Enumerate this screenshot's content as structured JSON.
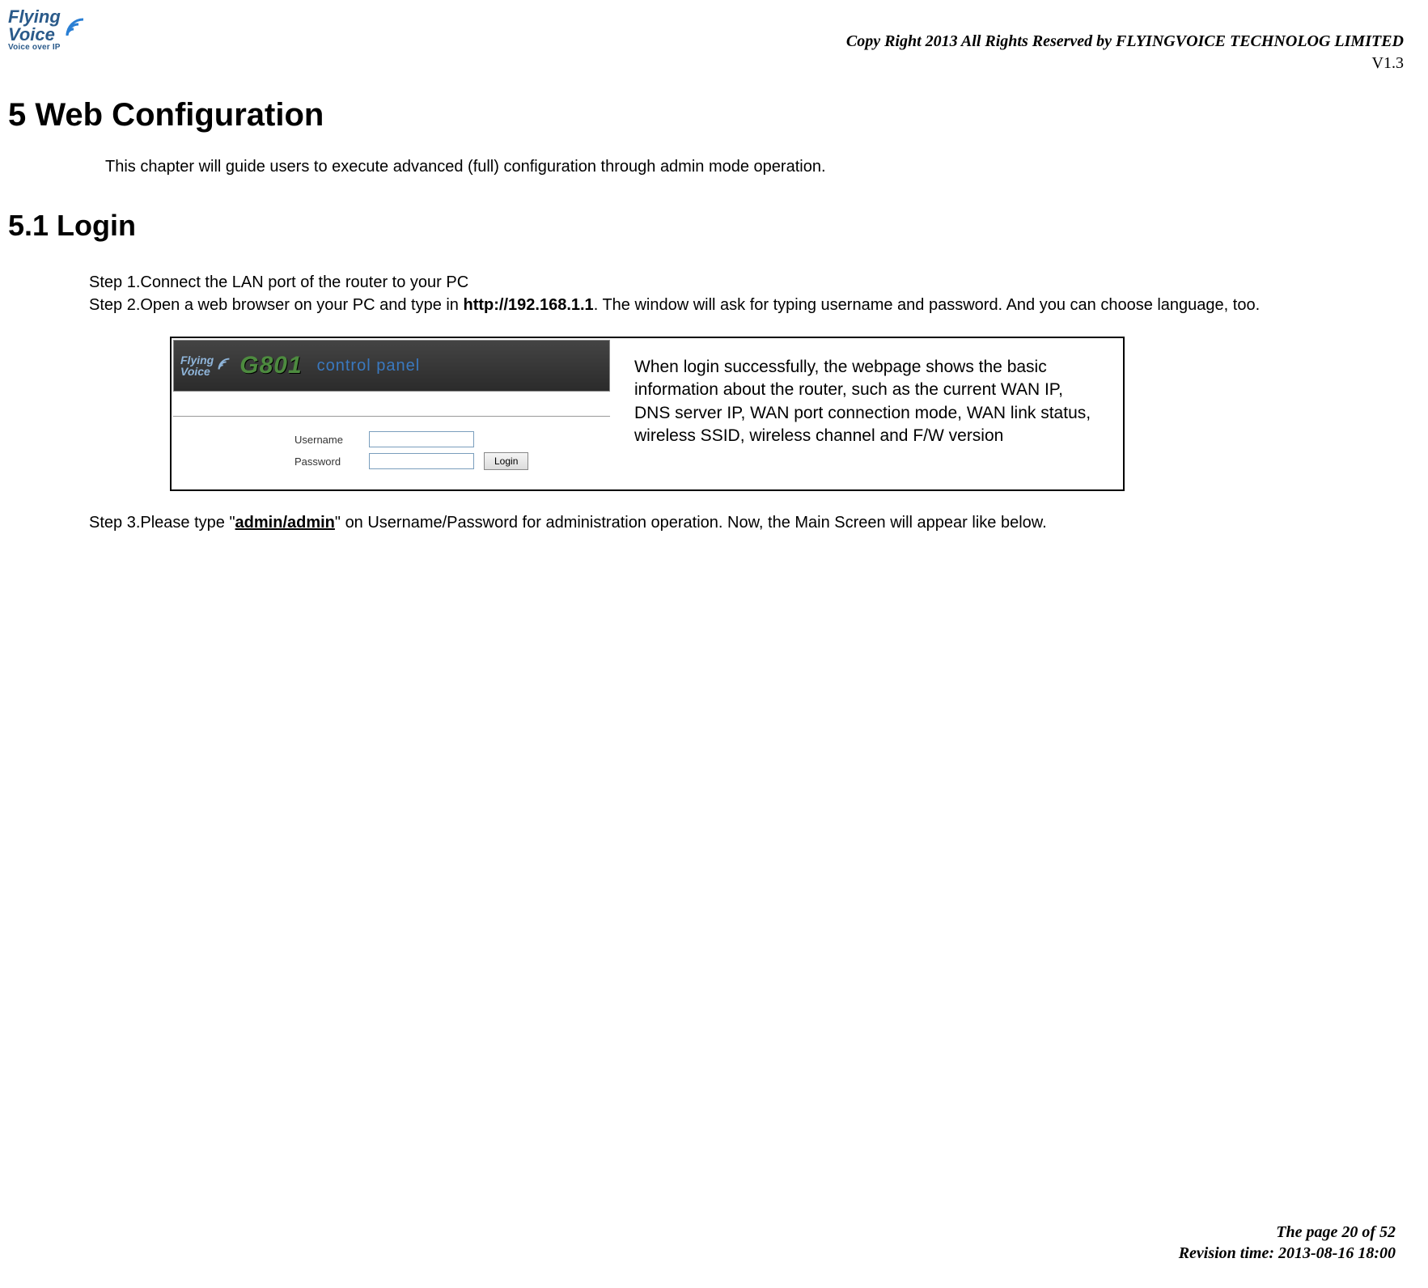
{
  "header": {
    "logo": {
      "line1": "Flying",
      "line2": "Voice",
      "sub": "Voice over IP"
    },
    "copyright": "Copy Right 2013 All Rights Reserved by FLYINGVOICE TECHNOLOG LIMITED",
    "version": "V1.3"
  },
  "title": "5   Web Configuration",
  "intro": "This chapter will guide users to execute advanced (full) configuration through admin mode operation.",
  "subtitle": "5.1 Login",
  "steps": {
    "s1": "Step 1.Connect the LAN port of the router to your PC",
    "s2a": "Step 2.Open a web browser on your PC and type in ",
    "s2b": "http://192.168.1.1",
    "s2c": ". The window will ask for typing username and password. And you can choose language, too.",
    "s3a": "Step 3.Please type \"",
    "s3b": "admin/admin",
    "s3c": "\" on Username/Password for administration operation. Now, the Main Screen will appear like below."
  },
  "login_panel": {
    "banner_logo": {
      "line1": "Flying",
      "line2": "Voice"
    },
    "model": "G801",
    "cp_text": "control panel",
    "username_label": "Username",
    "password_label": "Password",
    "login_button": "Login"
  },
  "note": "When login successfully, the webpage shows the basic information about the router, such as the current WAN IP, DNS server IP, WAN port connection mode, WAN link status, wireless SSID, wireless channel and F/W version",
  "footer": {
    "page": "The page 20 of 52",
    "revision": "Revision time: 2013-08-16 18:00"
  }
}
